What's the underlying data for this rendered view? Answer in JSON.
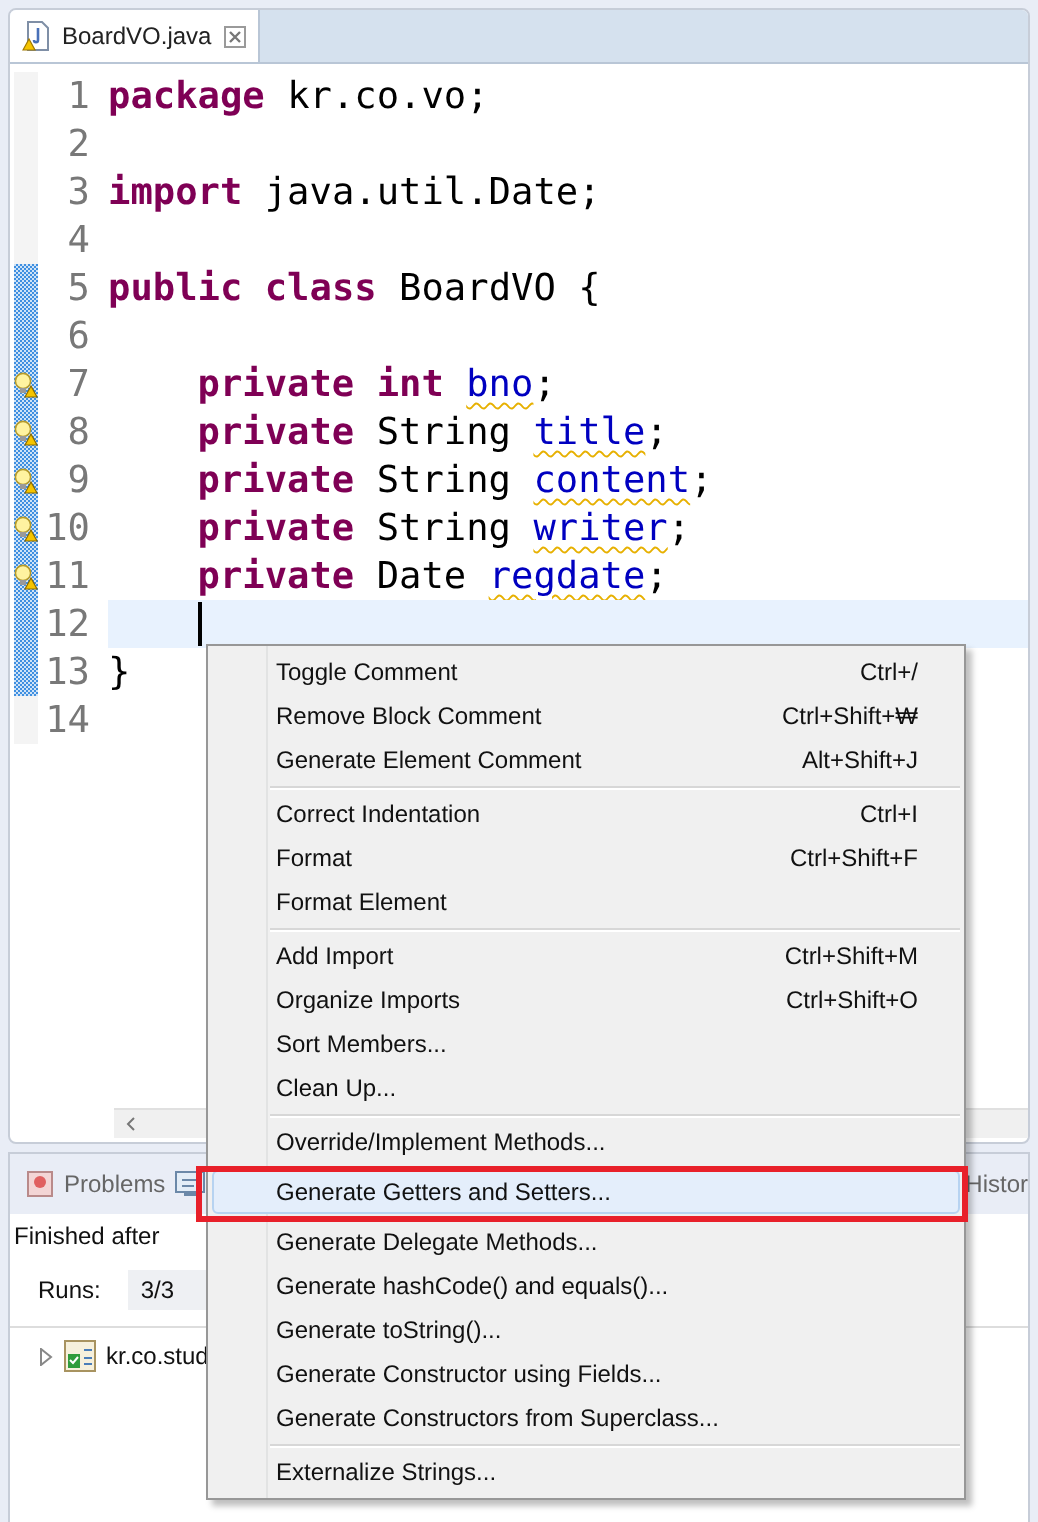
{
  "editor_tab": {
    "title": "BoardVO.java",
    "selected": true
  },
  "code_lines": [
    {
      "number": "1",
      "indented": false,
      "changed": false,
      "warning": false,
      "current": false,
      "tokens": [
        {
          "kind": "keyword",
          "text": "package"
        },
        {
          "kind": "plain",
          "text": " kr.co.vo;"
        }
      ]
    },
    {
      "number": "2",
      "changed": false,
      "warning": false,
      "current": false
    },
    {
      "number": "3",
      "indented": false,
      "changed": false,
      "warning": false,
      "current": false,
      "tokens": [
        {
          "kind": "keyword",
          "text": "import"
        },
        {
          "kind": "plain",
          "text": " java.util.Date;"
        }
      ]
    },
    {
      "number": "4",
      "changed": false,
      "warning": false,
      "current": false
    },
    {
      "number": "5",
      "indented": false,
      "changed": true,
      "warning": false,
      "current": false,
      "tokens": [
        {
          "kind": "keyword",
          "text": "public class"
        },
        {
          "kind": "plain",
          "text": " BoardVO {"
        }
      ]
    },
    {
      "number": "6",
      "changed": true,
      "warning": false,
      "current": false
    },
    {
      "number": "7",
      "indented": true,
      "changed": true,
      "warning": true,
      "current": false,
      "tokens": [
        {
          "kind": "keyword",
          "text": "private int "
        },
        {
          "kind": "field",
          "text": "bno"
        },
        {
          "kind": "plain",
          "text": ";"
        }
      ]
    },
    {
      "number": "8",
      "indented": true,
      "changed": true,
      "warning": true,
      "current": false,
      "tokens": [
        {
          "kind": "keyword",
          "text": "private"
        },
        {
          "kind": "plain",
          "text": " String "
        },
        {
          "kind": "field",
          "text": "title"
        },
        {
          "kind": "plain",
          "text": ";"
        }
      ]
    },
    {
      "number": "9",
      "indented": true,
      "changed": true,
      "warning": true,
      "current": false,
      "tokens": [
        {
          "kind": "keyword",
          "text": "private"
        },
        {
          "kind": "plain",
          "text": " String "
        },
        {
          "kind": "field",
          "text": "content"
        },
        {
          "kind": "plain",
          "text": ";"
        }
      ]
    },
    {
      "number": "10",
      "indented": true,
      "changed": true,
      "warning": true,
      "current": false,
      "tokens": [
        {
          "kind": "keyword",
          "text": "private"
        },
        {
          "kind": "plain",
          "text": " String "
        },
        {
          "kind": "field",
          "text": "writer"
        },
        {
          "kind": "plain",
          "text": ";"
        }
      ]
    },
    {
      "number": "11",
      "indented": true,
      "changed": true,
      "warning": true,
      "current": false,
      "tokens": [
        {
          "kind": "keyword",
          "text": "private"
        },
        {
          "kind": "plain",
          "text": " Date "
        },
        {
          "kind": "field",
          "text": "regdate"
        },
        {
          "kind": "plain",
          "text": ";"
        }
      ]
    },
    {
      "number": "12",
      "indented": true,
      "changed": true,
      "warning": false,
      "current": true
    },
    {
      "number": "13",
      "indented": false,
      "changed": true,
      "warning": false,
      "current": false,
      "tokens": [
        {
          "kind": "plain",
          "text": "}"
        }
      ]
    },
    {
      "number": "14",
      "changed": false,
      "warning": false,
      "current": false
    }
  ],
  "bottom_panel": {
    "tabs": [
      {
        "kind": "problems",
        "label": "Problems"
      },
      {
        "kind": "console"
      },
      {
        "kind": "history",
        "label": "Histor"
      }
    ],
    "status": "Finished after",
    "runs_label": "Runs:",
    "runs_value": "3/3",
    "tree": [
      {
        "label": "kr.co.stud",
        "expanded": false
      }
    ]
  },
  "context_menu": {
    "items": [
      {
        "kind": "item",
        "label": "Toggle Comment",
        "shortcut": "Ctrl+/",
        "selected": false
      },
      {
        "kind": "item",
        "label": "Remove Block Comment",
        "shortcut": "Ctrl+Shift+₩",
        "selected": false
      },
      {
        "kind": "item",
        "label": "Generate Element Comment",
        "shortcut": "Alt+Shift+J",
        "selected": false
      },
      {
        "kind": "separator"
      },
      {
        "kind": "item",
        "label": "Correct Indentation",
        "shortcut": "Ctrl+I",
        "selected": false
      },
      {
        "kind": "item",
        "label": "Format",
        "shortcut": "Ctrl+Shift+F",
        "selected": false
      },
      {
        "kind": "item",
        "label": "Format Element",
        "selected": false
      },
      {
        "kind": "separator"
      },
      {
        "kind": "item",
        "label": "Add Import",
        "shortcut": "Ctrl+Shift+M",
        "selected": false
      },
      {
        "kind": "item",
        "label": "Organize Imports",
        "shortcut": "Ctrl+Shift+O",
        "selected": false
      },
      {
        "kind": "item",
        "label": "Sort Members...",
        "selected": false
      },
      {
        "kind": "item",
        "label": "Clean Up...",
        "selected": false
      },
      {
        "kind": "separator"
      },
      {
        "kind": "item",
        "label": "Override/Implement Methods...",
        "selected": false
      },
      {
        "kind": "item",
        "label": "Generate Getters and Setters...",
        "selected": true
      },
      {
        "kind": "item",
        "label": "Generate Delegate Methods...",
        "selected": false
      },
      {
        "kind": "item",
        "label": "Generate hashCode() and equals()...",
        "selected": false
      },
      {
        "kind": "item",
        "label": "Generate toString()...",
        "selected": false
      },
      {
        "kind": "item",
        "label": "Generate Constructor using Fields...",
        "selected": false
      },
      {
        "kind": "item",
        "label": "Generate Constructors from Superclass...",
        "selected": false
      },
      {
        "kind": "separator"
      },
      {
        "kind": "item",
        "label": "Externalize Strings...",
        "selected": false
      }
    ]
  },
  "annotation": {
    "kind": "rectangle",
    "color": "#e8202a"
  }
}
